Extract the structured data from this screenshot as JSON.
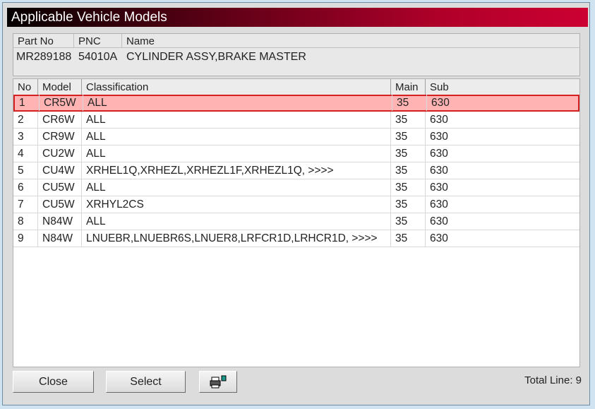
{
  "window": {
    "title": "Applicable Vehicle Models"
  },
  "part": {
    "headers": [
      "Part No",
      "PNC",
      "Name"
    ],
    "part_no": "MR289188",
    "pnc": "54010A",
    "name": "CYLINDER ASSY,BRAKE MASTER"
  },
  "table": {
    "headers": [
      "No",
      "Model",
      "Classification",
      "Main",
      "Sub"
    ],
    "selected_index": 0,
    "rows": [
      {
        "no": "1",
        "model": "CR5W",
        "classification": "ALL",
        "main": "35",
        "sub": "630"
      },
      {
        "no": "2",
        "model": "CR6W",
        "classification": "ALL",
        "main": "35",
        "sub": "630"
      },
      {
        "no": "3",
        "model": "CR9W",
        "classification": "ALL",
        "main": "35",
        "sub": "630"
      },
      {
        "no": "4",
        "model": "CU2W",
        "classification": "ALL",
        "main": "35",
        "sub": "630"
      },
      {
        "no": "5",
        "model": "CU4W",
        "classification": "XRHEL1Q,XRHEZL,XRHEZL1F,XRHEZL1Q,  >>>>",
        "main": "35",
        "sub": "630"
      },
      {
        "no": "6",
        "model": "CU5W",
        "classification": "ALL",
        "main": "35",
        "sub": "630"
      },
      {
        "no": "7",
        "model": "CU5W",
        "classification": "XRHYL2CS",
        "main": "35",
        "sub": "630"
      },
      {
        "no": "8",
        "model": "N84W",
        "classification": "ALL",
        "main": "35",
        "sub": "630"
      },
      {
        "no": "9",
        "model": "N84W",
        "classification": "LNUEBR,LNUEBR6S,LNUER8,LRFCR1D,LRHCR1D,  >>>>",
        "main": "35",
        "sub": "630"
      }
    ]
  },
  "footer": {
    "close_label": "Close",
    "select_label": "Select",
    "print_icon": "printer-icon",
    "total_label": "Total Line: 9"
  }
}
